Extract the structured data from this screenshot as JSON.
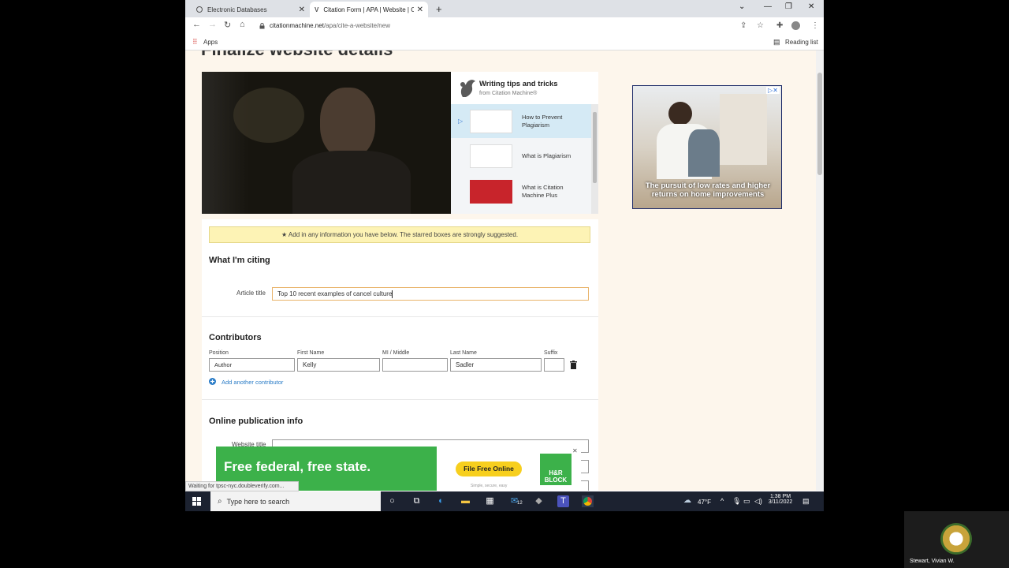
{
  "browser": {
    "tabs": [
      {
        "title": "Electronic Databases",
        "active": false
      },
      {
        "title": "Citation Form | APA | Website | C",
        "active": true
      }
    ],
    "url_host": "citationmachine.net",
    "url_path": "/apa/cite-a-website/new",
    "bookmarks": {
      "apps": "Apps",
      "reading_list": "Reading list"
    },
    "status": "Waiting for tpsc-nyc.doubleverify.com..."
  },
  "page": {
    "heading": "Finalize website details",
    "tips": {
      "title": "Writing tips and tricks",
      "subtitle": "from Citation Machine®",
      "items": [
        {
          "label": "How to Prevent Plagiarism",
          "selected": true
        },
        {
          "label": "What is Plagiarism",
          "selected": false
        },
        {
          "label": "What is Citation Machine Plus",
          "selected": false
        }
      ]
    },
    "ad_top": {
      "text": "The pursuit of low rates and higher returns on home improvements"
    },
    "form": {
      "notice": "★ Add in any information you have below. The starred boxes are strongly suggested.",
      "what_citing": {
        "title": "What I'm citing",
        "article_title_label": "Article title",
        "article_title_value": "Top 10 recent examples of cancel culture"
      },
      "contributors": {
        "title": "Contributors",
        "headers": {
          "position": "Position",
          "first": "First Name",
          "middle": "MI / Middle",
          "last": "Last Name",
          "suffix": "Suffix"
        },
        "row": {
          "position": "Author",
          "first": "Kelly",
          "middle": "",
          "last": "Sadler",
          "suffix": ""
        },
        "add_label": "Add another contributor"
      },
      "online": {
        "title": "Online publication info",
        "website_title_label": "Website title"
      }
    },
    "ad_bottom": {
      "headline": "Free federal, free state.",
      "cta": "File Free Online",
      "brand": "H&R BLOCK",
      "fine": "Simple, secure, easy"
    }
  },
  "taskbar": {
    "search_placeholder": "Type here to search",
    "weather": "47°F",
    "time": "1:38 PM",
    "date": "3/11/2022",
    "mail_badge": "12"
  },
  "participant": {
    "name": "Stewart, Vivian W."
  },
  "colors": {
    "accent": "#3cb14a",
    "page_bg": "#fdf6ec",
    "notice_bg": "#fdf3b5",
    "taskbar": "#1c2230"
  }
}
